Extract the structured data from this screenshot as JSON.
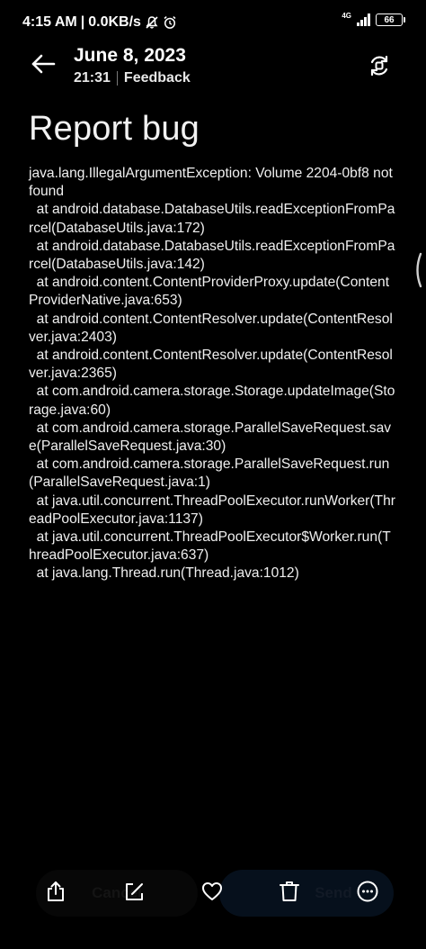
{
  "status_bar": {
    "time": "4:15 AM",
    "separator": "|",
    "speed": "0.0KB/s",
    "network": "4G",
    "battery": "66"
  },
  "header": {
    "date": "June 8, 2023",
    "time": "21:31",
    "feedback": "Feedback"
  },
  "page": {
    "title": "Report bug"
  },
  "trace": {
    "lines": [
      "java.lang.IllegalArgumentException: Volume 2204-0bf8 not found",
      "  at android.database.DatabaseUtils.readExceptionFromParcel(DatabaseUtils.java:172)",
      "  at android.database.DatabaseUtils.readExceptionFromParcel(DatabaseUtils.java:142)",
      "  at android.content.ContentProviderProxy.update(ContentProviderNative.java:653)",
      "  at android.content.ContentResolver.update(ContentResolver.java:2403)",
      "  at android.content.ContentResolver.update(ContentResolver.java:2365)",
      "  at com.android.camera.storage.Storage.updateImage(Storage.java:60)",
      "  at com.android.camera.storage.ParallelSaveRequest.save(ParallelSaveRequest.java:30)",
      "  at com.android.camera.storage.ParallelSaveRequest.run(ParallelSaveRequest.java:1)",
      "  at java.util.concurrent.ThreadPoolExecutor.runWorker(ThreadPoolExecutor.java:1137)",
      "  at java.util.concurrent.ThreadPoolExecutor$Worker.run(ThreadPoolExecutor.java:637)",
      "  at java.lang.Thread.run(Thread.java:1012)"
    ]
  },
  "bottom_bar": {
    "cancel_label": "Cancel",
    "send_label": "Send",
    "icons": [
      "share-icon",
      "edit-icon",
      "favorite-icon",
      "delete-icon",
      "more-icon"
    ]
  }
}
